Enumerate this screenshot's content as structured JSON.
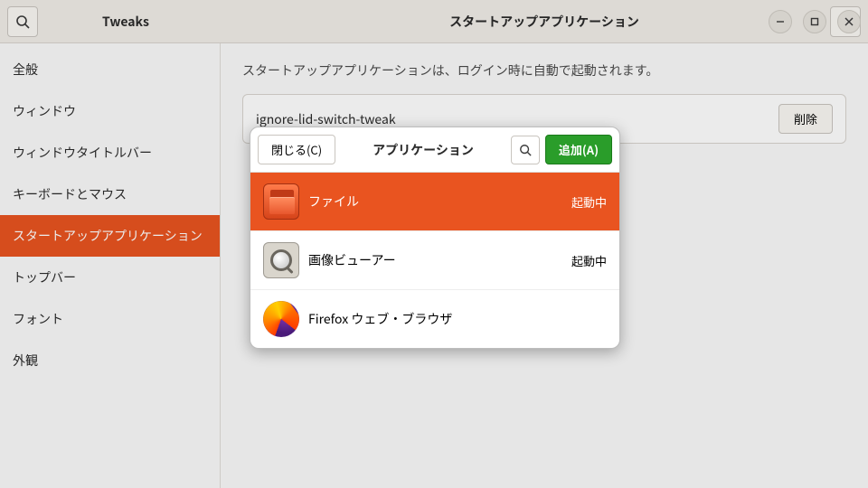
{
  "colors": {
    "accent": "#e95420",
    "add_button": "#2a9d2a"
  },
  "titlebar": {
    "app_title": "Tweaks",
    "window_title": "スタートアップアプリケーション"
  },
  "sidebar": {
    "items": [
      {
        "label": "全般"
      },
      {
        "label": "ウィンドウ"
      },
      {
        "label": "ウィンドウタイトルバー"
      },
      {
        "label": "キーボードとマウス"
      },
      {
        "label": "スタートアップアプリケーション"
      },
      {
        "label": "トップバー"
      },
      {
        "label": "フォント"
      },
      {
        "label": "外観"
      }
    ],
    "active_index": 4
  },
  "content": {
    "description": "スタートアップアプリケーションは、ログイン時に自動で起動されます。",
    "entries": [
      {
        "name": "ignore-lid-switch-tweak",
        "remove_label": "削除"
      }
    ]
  },
  "popover": {
    "close_label": "閉じる(C)",
    "title": "アプリケーション",
    "add_label": "追加(A)",
    "apps": [
      {
        "icon": "files-icon",
        "label": "ファイル",
        "status": "起動中",
        "selected": true
      },
      {
        "icon": "image-viewer-icon",
        "label": "画像ビューアー",
        "status": "起動中",
        "selected": false
      },
      {
        "icon": "firefox-icon",
        "label": "Firefox ウェブ・ブラウザ",
        "status": "",
        "selected": false
      }
    ]
  }
}
